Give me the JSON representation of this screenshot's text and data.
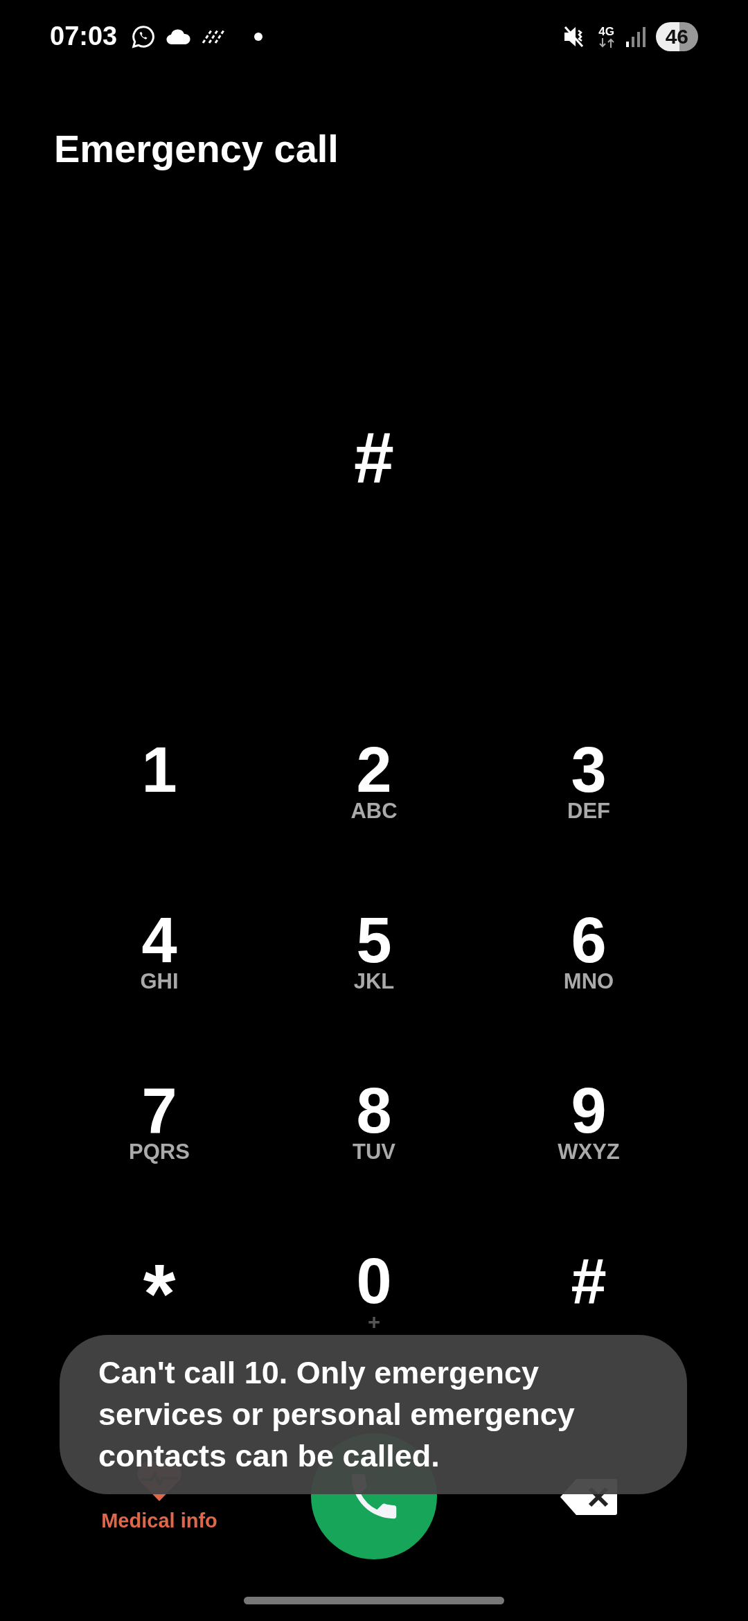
{
  "status_bar": {
    "time": "07:03",
    "network": "4G",
    "battery": "46"
  },
  "title": "Emergency call",
  "display": "#",
  "keys": [
    {
      "digit": "1"
    },
    {
      "digit": "2",
      "letters": "ABC"
    },
    {
      "digit": "3",
      "letters": "DEF"
    },
    {
      "digit": "4",
      "letters": "GHI"
    },
    {
      "digit": "5",
      "letters": "JKL"
    },
    {
      "digit": "6",
      "letters": "MNO"
    },
    {
      "digit": "7",
      "letters": "PQRS"
    },
    {
      "digit": "8",
      "letters": "TUV"
    },
    {
      "digit": "9",
      "letters": "WXYZ"
    },
    {
      "digit": "*"
    },
    {
      "digit": "0",
      "letters": "+"
    },
    {
      "digit": "#"
    }
  ],
  "medical_info": "Medical info",
  "toast": "Can't call 10. Only emergency services or personal emergency contacts can be called."
}
